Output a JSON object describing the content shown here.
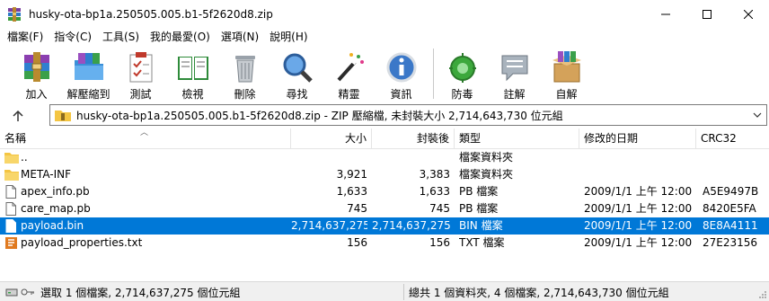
{
  "window": {
    "title": "husky-ota-bp1a.250505.005.b1-5f2620d8.zip"
  },
  "menu": [
    "檔案(F)",
    "指令(C)",
    "工具(S)",
    "我的最愛(O)",
    "選項(N)",
    "說明(H)"
  ],
  "toolbar": [
    {
      "label": "加入",
      "icon": "add-archive-icon"
    },
    {
      "label": "解壓縮到",
      "icon": "extract-to-icon"
    },
    {
      "label": "測試",
      "icon": "test-icon"
    },
    {
      "label": "檢視",
      "icon": "view-icon"
    },
    {
      "label": "刪除",
      "icon": "delete-icon"
    },
    {
      "label": "尋找",
      "icon": "find-icon"
    },
    {
      "label": "精靈",
      "icon": "wizard-icon"
    },
    {
      "label": "資訊",
      "icon": "info-icon"
    },
    {
      "label": "防毒",
      "icon": "virus-scan-icon"
    },
    {
      "label": "註解",
      "icon": "comment-icon"
    },
    {
      "label": "自解",
      "icon": "sfx-icon"
    }
  ],
  "address": {
    "text": "husky-ota-bp1a.250505.005.b1-5f2620d8.zip - ZIP 壓縮檔, 未封裝大小 2,714,643,730 位元組"
  },
  "columns": {
    "name": "名稱",
    "size": "大小",
    "packed": "封裝後",
    "type": "類型",
    "modified": "修改的日期",
    "crc": "CRC32"
  },
  "files": [
    {
      "name": "..",
      "size": "",
      "packed": "",
      "type": "檔案資料夾",
      "modified": "",
      "crc": "",
      "icon": "folder-icon",
      "selected": false
    },
    {
      "name": "META-INF",
      "size": "3,921",
      "packed": "3,383",
      "type": "檔案資料夾",
      "modified": "",
      "crc": "",
      "icon": "folder-icon",
      "selected": false
    },
    {
      "name": "apex_info.pb",
      "size": "1,633",
      "packed": "1,633",
      "type": "PB 檔案",
      "modified": "2009/1/1 上午 12:00",
      "crc": "A5E9497B",
      "icon": "file-icon",
      "selected": false
    },
    {
      "name": "care_map.pb",
      "size": "745",
      "packed": "745",
      "type": "PB 檔案",
      "modified": "2009/1/1 上午 12:00",
      "crc": "8420E5FA",
      "icon": "file-icon",
      "selected": false
    },
    {
      "name": "payload.bin",
      "size": "2,714,637,275",
      "packed": "2,714,637,275",
      "type": "BIN 檔案",
      "modified": "2009/1/1 上午 12:00",
      "crc": "8E8A4111",
      "icon": "file-icon",
      "selected": true
    },
    {
      "name": "payload_properties.txt",
      "size": "156",
      "packed": "156",
      "type": "TXT 檔案",
      "modified": "2009/1/1 上午 12:00",
      "crc": "27E23156",
      "icon": "text-file-icon",
      "selected": false
    }
  ],
  "status": {
    "left": "選取 1 個檔案, 2,714,637,275 個位元組",
    "right": "總共 1 個資料夾, 4 個檔案, 2,714,643,730 個位元組"
  },
  "colors": {
    "selection": "#0078d7",
    "folder": "#f4c542"
  }
}
